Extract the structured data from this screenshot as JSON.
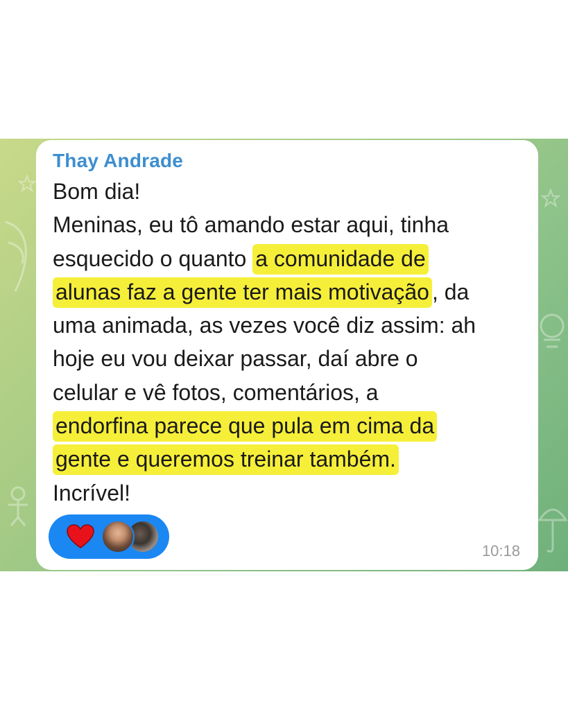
{
  "message": {
    "sender": "Thay Andrade",
    "lines": [
      [
        {
          "text": "Bom dia!",
          "hl": false
        }
      ],
      [
        {
          "text": "Meninas,  eu tô amando estar aqui,  tinha",
          "hl": false
        }
      ],
      [
        {
          "text": "esquecido o quanto ",
          "hl": false
        },
        {
          "text": "a comunidade de",
          "hl": true
        }
      ],
      [
        {
          "text": "alunas faz a gente ter mais motivação",
          "hl": true
        },
        {
          "text": ",  da",
          "hl": false
        }
      ],
      [
        {
          "text": "uma animada, as vezes você diz assim: ah",
          "hl": false
        }
      ],
      [
        {
          "text": "hoje eu vou deixar passar,  daí abre o",
          "hl": false
        }
      ],
      [
        {
          "text": "celular e vê fotos, comentários, a",
          "hl": false
        }
      ],
      [
        {
          "text": "endorfina parece que pula em cima da",
          "hl": true
        }
      ],
      [
        {
          "text": "gente e queremos treinar também.",
          "hl": true
        }
      ],
      [
        {
          "text": "Incrível!",
          "hl": false
        }
      ]
    ],
    "time": "10:18",
    "reactions": {
      "emoji_icon": "heart-icon",
      "emoji_color": "#e8121a",
      "avatars": [
        "reactor-avatar-1",
        "reactor-avatar-2"
      ]
    }
  },
  "colors": {
    "sender": "#3d8ed0",
    "highlight": "#f6ef3a",
    "reaction_pill": "#1b87f2",
    "timestamp": "#9a9a9a"
  }
}
